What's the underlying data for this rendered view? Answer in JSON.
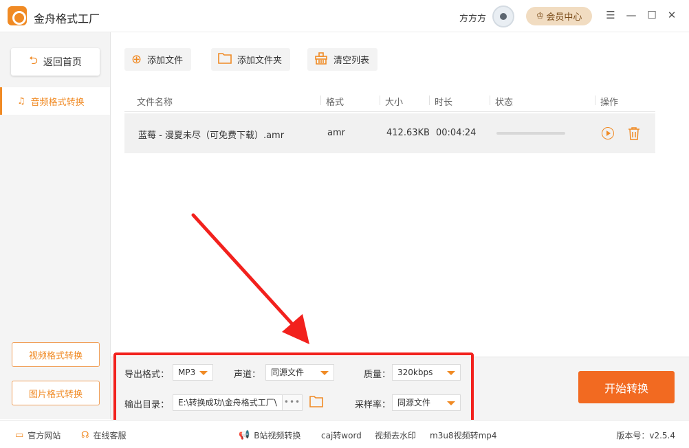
{
  "app": {
    "title": "金舟格式工厂",
    "user_name": "方方方",
    "vip_label": "会员中心"
  },
  "sidebar": {
    "back_label": "返回首页",
    "active_item": "音频格式转换",
    "video_btn": "视频格式转换",
    "image_btn": "图片格式转换"
  },
  "toolbar": {
    "add_file": "添加文件",
    "add_folder": "添加文件夹",
    "clear_list": "清空列表"
  },
  "table": {
    "columns": [
      "文件名称",
      "格式",
      "大小",
      "时长",
      "状态",
      "操作"
    ],
    "rows": [
      {
        "name": "蓝莓 - 漫夏未尽（可免费下载）.amr",
        "format": "amr",
        "size": "412.63KB",
        "duration": "00:04:24",
        "progress": 0
      }
    ]
  },
  "settings": {
    "format_label": "导出格式：",
    "format_value": "MP3",
    "channel_label": "声道：",
    "channel_value": "同源文件",
    "quality_label": "质量：",
    "quality_value": "320kbps",
    "output_label": "输出目录：",
    "output_path": "E:\\转换成功\\金舟格式工厂\\",
    "more": "•••",
    "samplerate_label": "采样率：",
    "samplerate_value": "同源文件",
    "start_label": "开始转换"
  },
  "footer": {
    "website": "官方网站",
    "service": "在线客服",
    "promo1": "B站视频转换",
    "promo2": "caj转word",
    "promo3": "视频去水印",
    "promo4": "m3u8视频转mp4",
    "version": "版本号：v2.5.4"
  },
  "colors": {
    "accent": "#f08a24",
    "start_button": "#f26a21",
    "highlight_red": "#f2211d"
  }
}
